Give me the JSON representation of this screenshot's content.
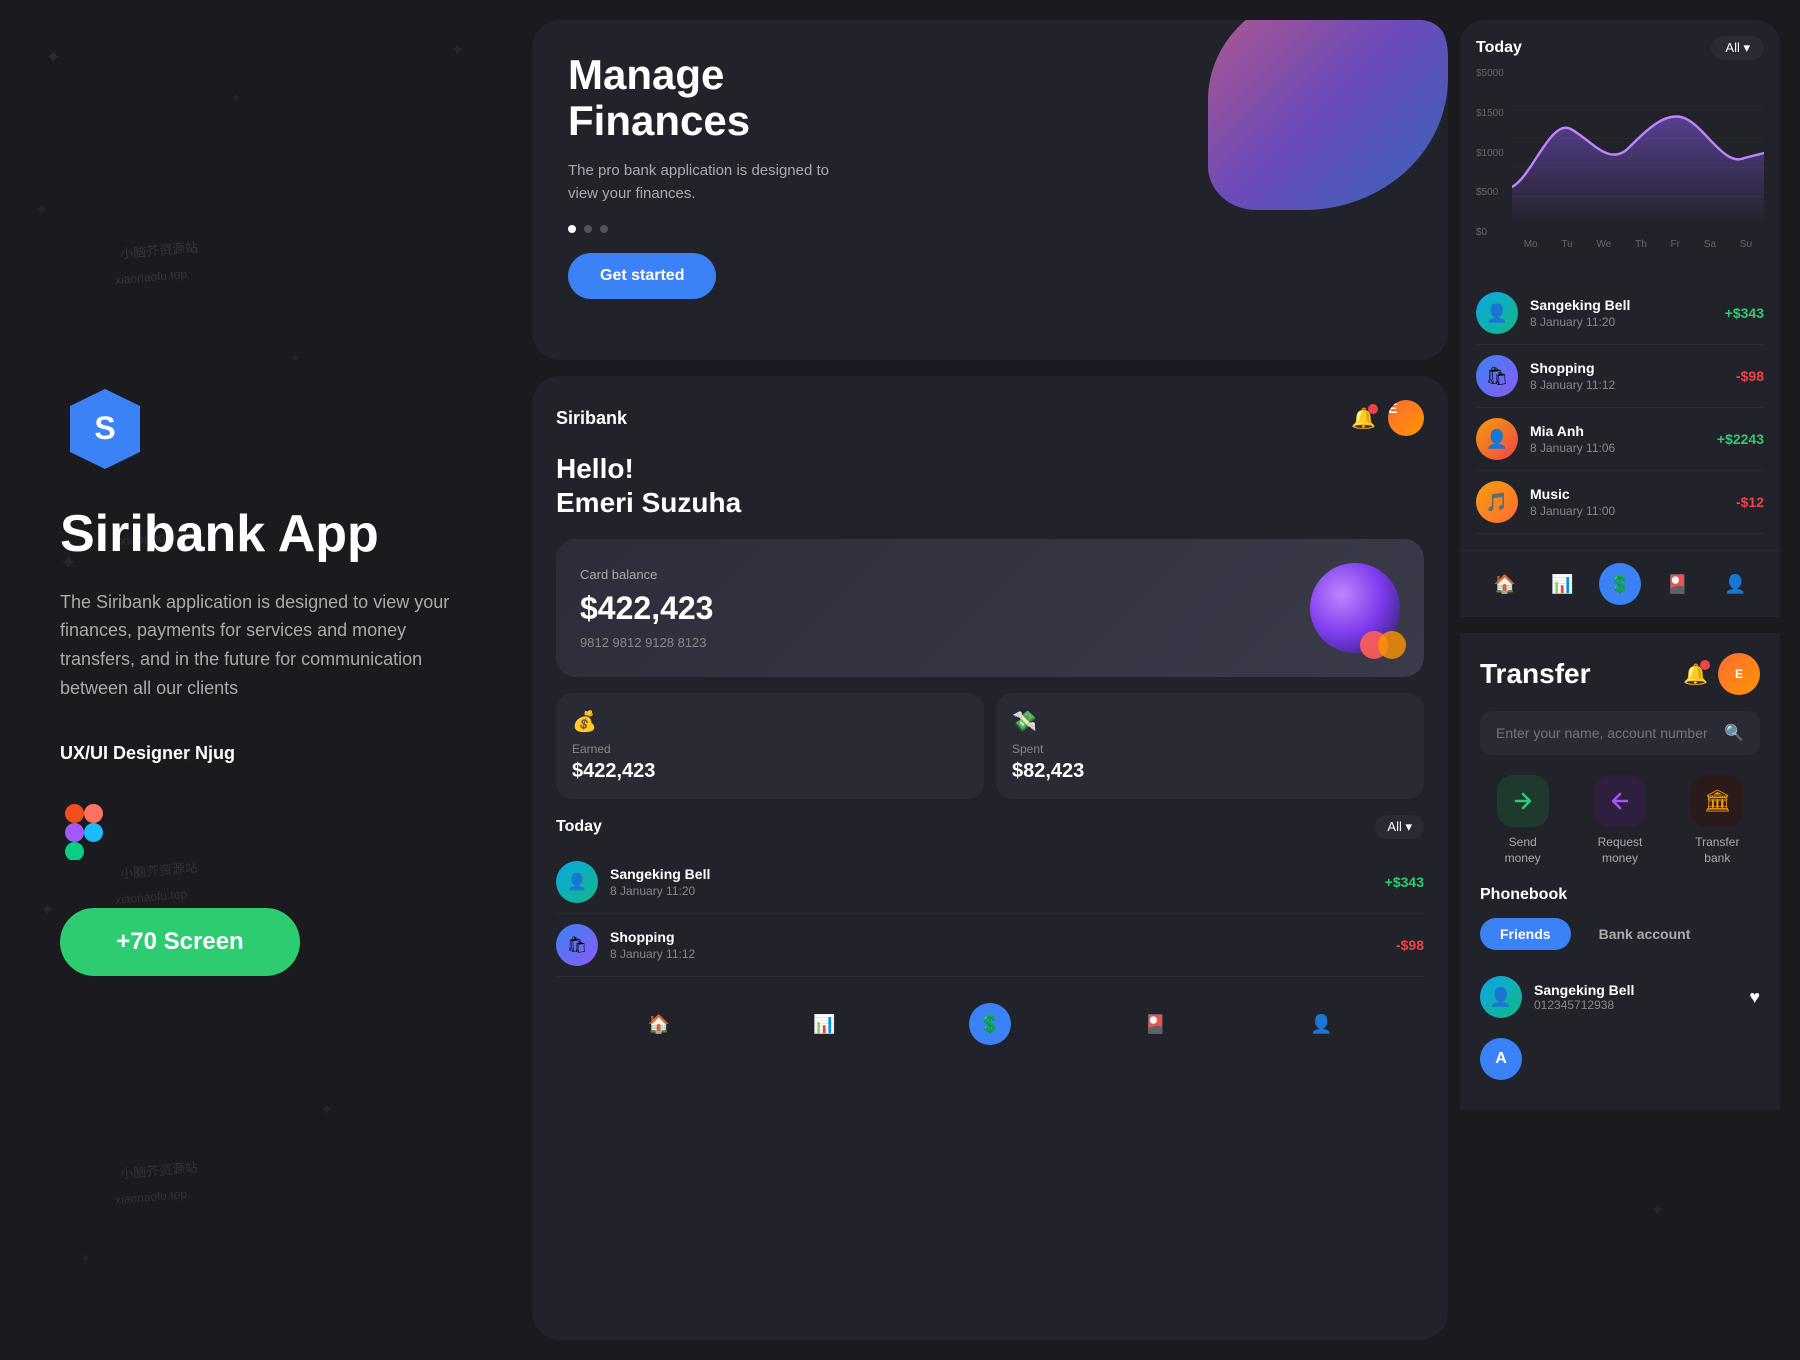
{
  "watermarks": [
    "小脑芥资源站",
    "xiaonaofu.top"
  ],
  "left": {
    "logo_letter": "S",
    "title": "Siribank App",
    "description": "The Siribank application is designed to view your finances, payments for services and money transfers, and in the future for communication between all our clients",
    "designer_label": "UX/UI Designer Njug",
    "screen_count": "+70 Screen"
  },
  "intro_phone": {
    "heading_line1": "Manage",
    "heading_line2": "Finances",
    "description": "The pro bank application is designed to view your finances.",
    "cta_label": "Get started"
  },
  "main_phone": {
    "brand": "Siribank",
    "greeting_line1": "Hello!",
    "greeting_line2": "Emeri Suzuha",
    "card": {
      "label": "Card balance",
      "amount": "$422,423",
      "card_number": "9812 9812 9128 8123"
    },
    "stats": [
      {
        "icon": "💰",
        "label": "Earned",
        "amount": "$422,423"
      },
      {
        "icon": "💸",
        "label": "Spent",
        "amount": "$82,423"
      }
    ],
    "today_label": "Today",
    "all_label": "All",
    "transactions": [
      {
        "name": "Sangeking Bell",
        "date": "8 January 11:20",
        "amount": "+$343",
        "positive": true
      },
      {
        "name": "Shopping",
        "date": "8 January 11:12",
        "amount": "-$98",
        "positive": false
      }
    ],
    "nav": [
      "🏠",
      "📊",
      "💲",
      "🎴",
      "👤"
    ]
  },
  "chart": {
    "y_labels": [
      "$5000",
      "$1500",
      "$1000",
      "$500",
      "$0"
    ],
    "x_labels": [
      "Mo",
      "Tu",
      "We",
      "Th",
      "Fr",
      "Sa",
      "Su"
    ],
    "title": "Today",
    "all_label": "All"
  },
  "right_transactions": [
    {
      "name": "Sangeking Bell",
      "date": "8 January 11:20",
      "amount": "+$343",
      "positive": true
    },
    {
      "name": "Shopping",
      "date": "8 January 11:12",
      "amount": "-$98",
      "positive": false
    },
    {
      "name": "Mia Anh",
      "date": "8 January 11:06",
      "amount": "+$2243",
      "positive": true
    },
    {
      "name": "Music",
      "date": "8 January 11:00",
      "amount": "-$12",
      "positive": false
    }
  ],
  "transfer": {
    "title": "Transfer",
    "search_placeholder": "Enter your name, account number",
    "quick_actions": [
      {
        "label": "Send\nmoney",
        "icon": "↗"
      },
      {
        "label": "Request\nmoney",
        "icon": "↙"
      },
      {
        "label": "Transfer\nbank",
        "icon": "🏛"
      }
    ],
    "phonebook_title": "Phonebook",
    "tabs": [
      "Friends",
      "Bank account"
    ],
    "contacts": [
      {
        "name": "Sangeking Bell",
        "number": "012345712938"
      }
    ],
    "contact_initial": "A"
  }
}
